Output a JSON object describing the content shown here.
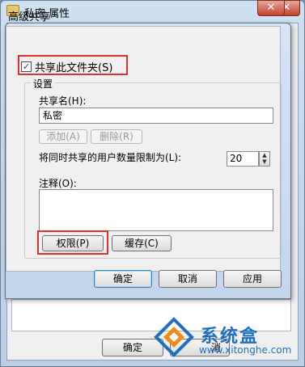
{
  "outer_window": {
    "title": "私密 属性",
    "close_glyph": "✕",
    "ok_label": "确定",
    "cancel_label_partial": "消"
  },
  "dialog": {
    "title": "高级共享",
    "close_glyph": "✕",
    "share_checkbox": {
      "label": "共享此文件夹(S)",
      "checked": true
    },
    "settings_group_title": "设置",
    "share_name_label": "共享名(H):",
    "share_name_value": "私密",
    "add_button": "添加(A)",
    "remove_button": "删除(R)",
    "user_limit_label": "将同时共享的用户数量限制为(L):",
    "user_limit_value": "20",
    "comment_label": "注释(O):",
    "comment_value": "",
    "permissions_button": "权限(P)",
    "caching_button": "缓存(C)",
    "ok_button": "确定",
    "cancel_button": "取消",
    "apply_button": "应用"
  },
  "watermark": {
    "text": "系统盒",
    "url": "www.xitonghe.com"
  },
  "colors": {
    "highlight": "#e03030",
    "title_bar": "#c3d6ec",
    "watermark": "#1f6fbf"
  }
}
